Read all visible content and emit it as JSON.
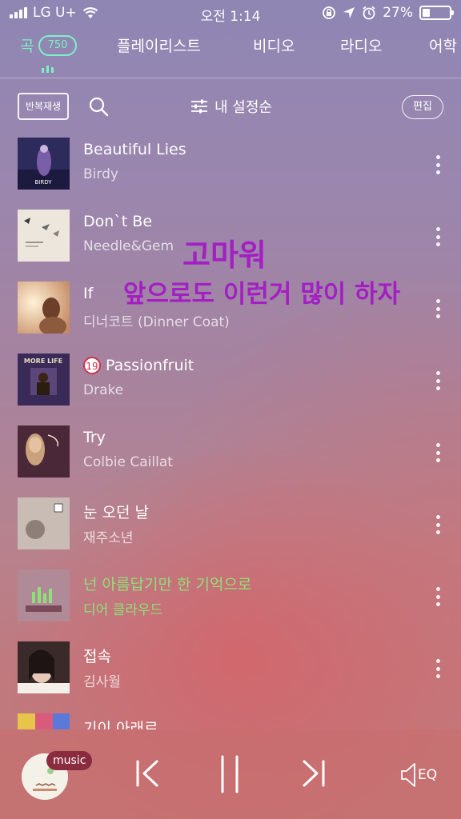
{
  "status_bar": {
    "carrier": "LG U+",
    "time": "오전 1:14",
    "battery": "27%",
    "battery_level": 0.27
  },
  "tabs": [
    {
      "label": "곡",
      "badge": "750",
      "active": true
    },
    {
      "label": "플레이리스트",
      "active": false
    },
    {
      "label": "비디오",
      "active": false
    },
    {
      "label": "라디오",
      "active": false
    },
    {
      "label": "어학",
      "active": false
    }
  ],
  "toolbar": {
    "repeat_label": "반복재생",
    "sort_label": "내 설정순",
    "edit_label": "편집"
  },
  "songs": [
    {
      "title": "Beautiful Lies",
      "artist": "Birdy",
      "art_text": "BIRDY"
    },
    {
      "title": "Don`t Be",
      "artist": "Needle&Gem"
    },
    {
      "title": "If",
      "artist": "디너코트 (Dinner Coat)"
    },
    {
      "title": "Passionfruit",
      "artist": "Drake",
      "age_badge": "19",
      "art_text": "MORE LIFE"
    },
    {
      "title": "Try",
      "artist": "Colbie Caillat"
    },
    {
      "title": "눈 오던 날",
      "artist": "재주소년"
    },
    {
      "title": "넌 아름답기만 한 기억으로",
      "artist": "디어 클라우드",
      "playing": true
    },
    {
      "title": "접속",
      "artist": "김사월"
    },
    {
      "title": "기이 아래르",
      "artist": ""
    }
  ],
  "overlay": {
    "line1": "고마워",
    "line2": "앞으로도 이런거 많이 하자"
  },
  "player": {
    "badge": "music",
    "eq_label": "EQ"
  },
  "colors": {
    "accent": "#7ef0c8",
    "playing": "#8fe078",
    "overlay_text": "#a41fc3"
  }
}
